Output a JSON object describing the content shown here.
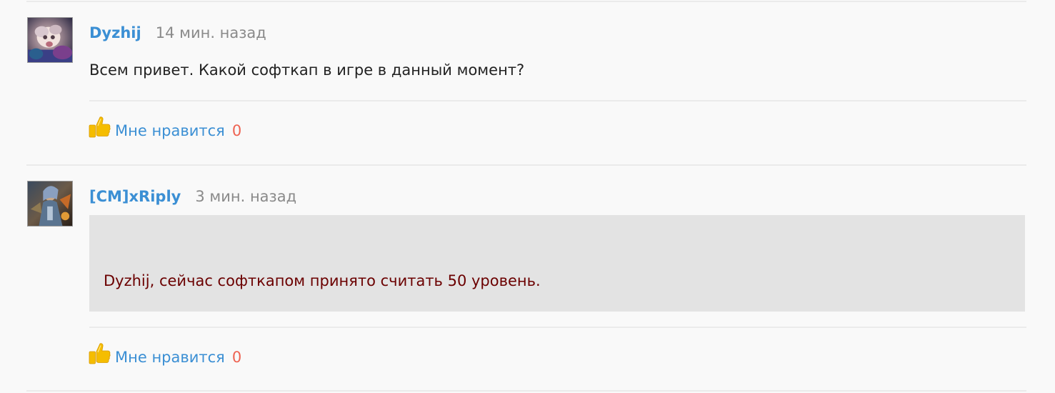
{
  "comments": [
    {
      "author": "Dyzhij",
      "time": "14 мин. назад",
      "text": "Всем привет. Какой софткап в игре в данный момент?",
      "like_label": "Мне нравится",
      "like_count": "0"
    },
    {
      "author": "[CM]xRiply",
      "time": "3 мин. назад",
      "quote_text": "Dyzhij, сейчас софткапом принято считать 50 уровень.",
      "like_label": "Мне нравится",
      "like_count": "0"
    }
  ],
  "colors": {
    "author": "#3b8fd4",
    "timestamp": "#8a8a8a",
    "like_count": "#ee6352",
    "quote_text": "#6b0000",
    "quote_background": "#e3e3e3"
  },
  "icons": {
    "like": "thumbs-up-icon"
  }
}
